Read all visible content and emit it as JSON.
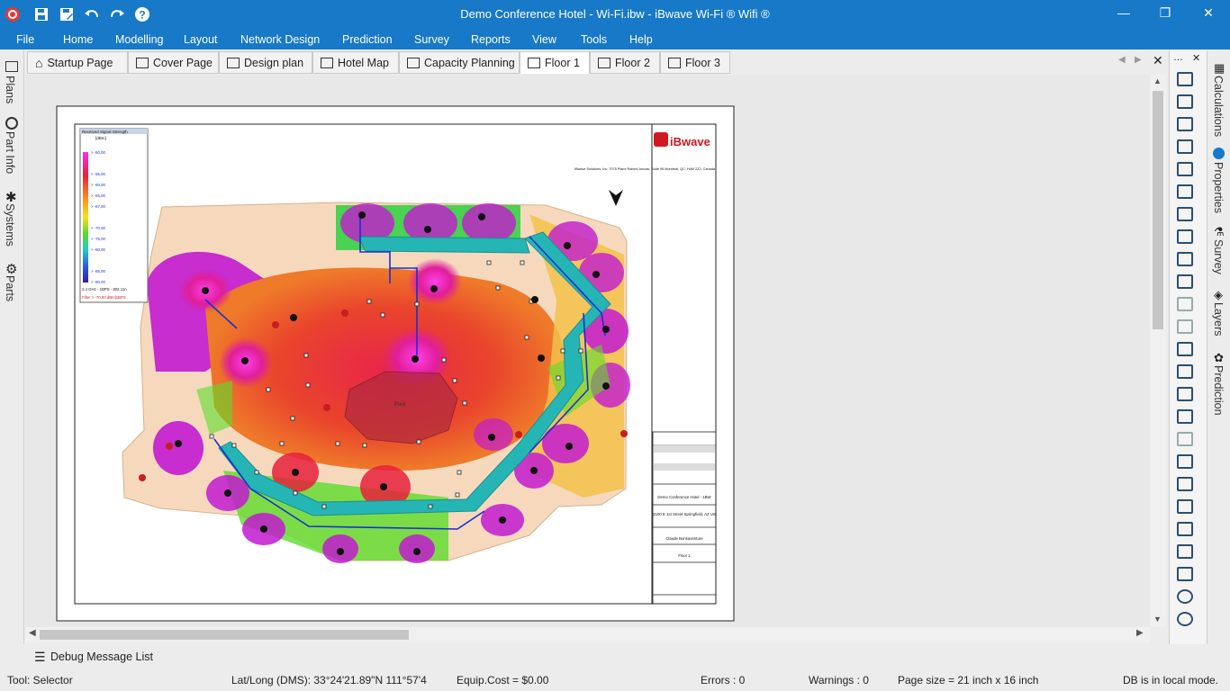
{
  "window": {
    "title": "Demo Conference Hotel - Wi-Fi.ibw - iBwave Wi-Fi ® Wifi ®"
  },
  "menu": [
    "File",
    "Home",
    "Modelling",
    "Layout",
    "Network Design",
    "Prediction",
    "Survey",
    "Reports",
    "View",
    "Tools",
    "Help"
  ],
  "tabs": [
    {
      "label": "Startup Page"
    },
    {
      "label": "Cover Page"
    },
    {
      "label": "Design plan"
    },
    {
      "label": "Hotel Map"
    },
    {
      "label": "Capacity Planning"
    },
    {
      "label": "Floor 1",
      "active": true
    },
    {
      "label": "Floor 2"
    },
    {
      "label": "Floor 3"
    }
  ],
  "left_panels": [
    "Plans",
    "Part Info",
    "Systems",
    "Parts"
  ],
  "right_panels": [
    "Calculations",
    "Properties",
    "Survey",
    "Layers",
    "Prediction"
  ],
  "sheet": {
    "company": "iBwave",
    "company_address": "iBwave Solutions, Inc. 7075 Place Robert-Joncas, Suite 95 Montreal, QC, H4M 2Z2, Canada",
    "project": "Demo Conference Hotel - 1BW",
    "address": "2100 E 1st Street Springfield, AZ US",
    "designer": "Claude Bonsaventure",
    "floor": "Floor 1",
    "center_label": "Pool",
    "legend_title": "Received Signal Strength",
    "legend_unit": "[dBm]",
    "legend_values": [
      "> -50,00",
      "> -55,00",
      "> -60,00",
      "> -65,00",
      "> -67,00",
      "> -70,00",
      "> -75,00",
      "> -80,00",
      "> -85,00",
      "> -90,00",
      "> -100,00"
    ],
    "legend_band": "2.4 GHz - 1BPS - 802.11n",
    "legend_filter": "Filter > -70.00 dBm|1BPS"
  },
  "debug": {
    "label": "Debug Message List"
  },
  "status": {
    "tool": "Tool: Selector",
    "latlong": "Lat/Long (DMS):  33°24'21.89\"N 111°57'4",
    "cost": "Equip.Cost = $0.00",
    "errors": "Errors : 0",
    "warnings": "Warnings : 0",
    "page_size": "Page size = 21 inch x 16 inch",
    "db": "DB is in local mode."
  },
  "colors": {
    "accent": "#1779c8",
    "hallway": "#26b5b5",
    "strong": "#d9008a",
    "medium": "#e85a2a",
    "weak": "#f2dcc7"
  }
}
